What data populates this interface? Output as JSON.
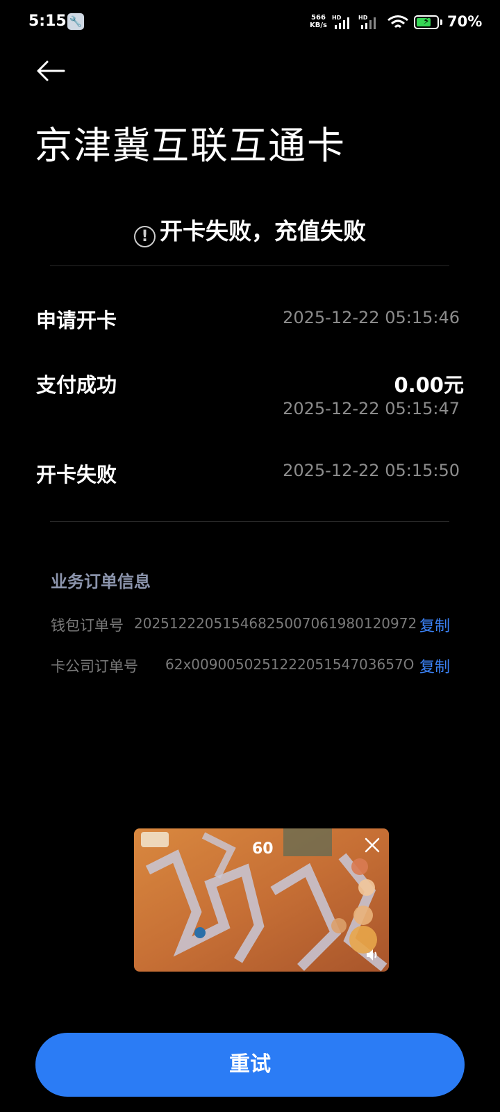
{
  "status_bar": {
    "time": "5:15",
    "net_speed_value": "566",
    "net_speed_unit": "KB/s",
    "signal_tag_1": "HD",
    "signal_tag_2": "HD",
    "battery_percent": "70%",
    "battery_level": 0.7
  },
  "page": {
    "title": "京津冀互联互通卡",
    "status_message": "开卡失败，充值失败"
  },
  "steps": [
    {
      "label": "申请开卡",
      "time": "2025-12-22 05:15:46"
    },
    {
      "label": "支付成功",
      "amount": "0.00元",
      "time": "2025-12-22 05:15:47"
    },
    {
      "label": "开卡失败",
      "time": "2025-12-22 05:15:50"
    }
  ],
  "order_info": {
    "title": "业务订单信息",
    "wallet_label": "钱包订单号",
    "wallet_number": "20251222051546825007061980120972",
    "card_company_label": "卡公司订单号",
    "card_company_number": "62x009005025122205154703657O",
    "copy_label": "复制"
  },
  "floating_video": {
    "counter": "60"
  },
  "retry_label": "重试",
  "colors": {
    "accent": "#2b7cf5",
    "link": "#3b82f6",
    "background": "#000000"
  }
}
